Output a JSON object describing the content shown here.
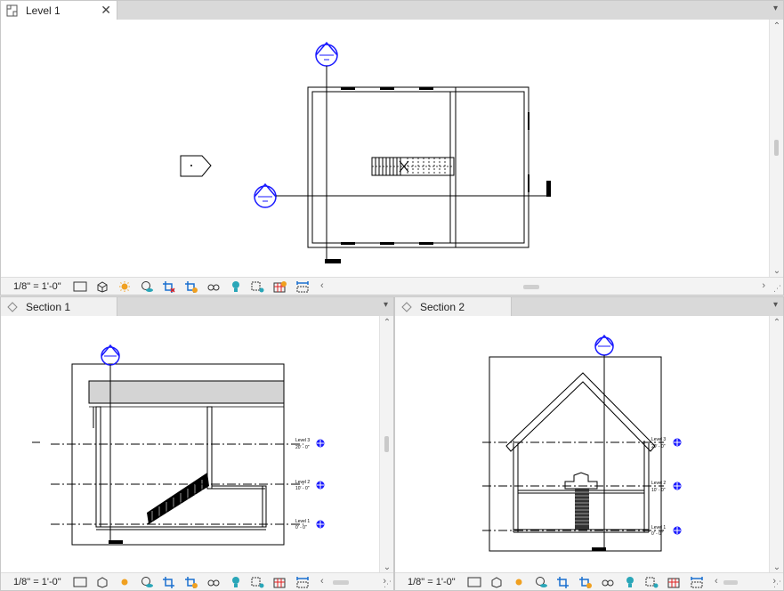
{
  "top_view": {
    "tab_label": "Level 1",
    "close_symbol": "✕",
    "scale": "1/8\" = 1'-0\""
  },
  "section1": {
    "tab_label": "Section 1",
    "scale": "1/8\" = 1'-0\"",
    "levels": [
      {
        "name": "Level 3",
        "elev": "20' - 0\""
      },
      {
        "name": "Level 2",
        "elev": "10' - 0\""
      },
      {
        "name": "Level 1",
        "elev": "0' - 0\""
      }
    ]
  },
  "section2": {
    "tab_label": "Section 2",
    "scale": "1/8\" = 1'-0\"",
    "levels": [
      {
        "name": "Level 3",
        "elev": "20' - 0\""
      },
      {
        "name": "Level 2",
        "elev": "10' - 0\""
      },
      {
        "name": "Level 1",
        "elev": "0' - 0\""
      }
    ]
  },
  "toolbar_icons": [
    "detail-level-icon",
    "visual-style-icon",
    "sun-path-icon",
    "shadows-icon",
    "crop-view-icon",
    "show-crop-icon",
    "temporary-hide-icon",
    "reveal-hidden-icon",
    "analytical-model-icon",
    "highlight-displacement-icon",
    "reveal-constraints-icon",
    "worksharing-icon"
  ],
  "colors": {
    "accent_blue": "#1a1aff",
    "tab_bg": "#d9d9d9",
    "orange": "#f0a020",
    "red": "#e02020",
    "teal": "#2aa6b8"
  }
}
